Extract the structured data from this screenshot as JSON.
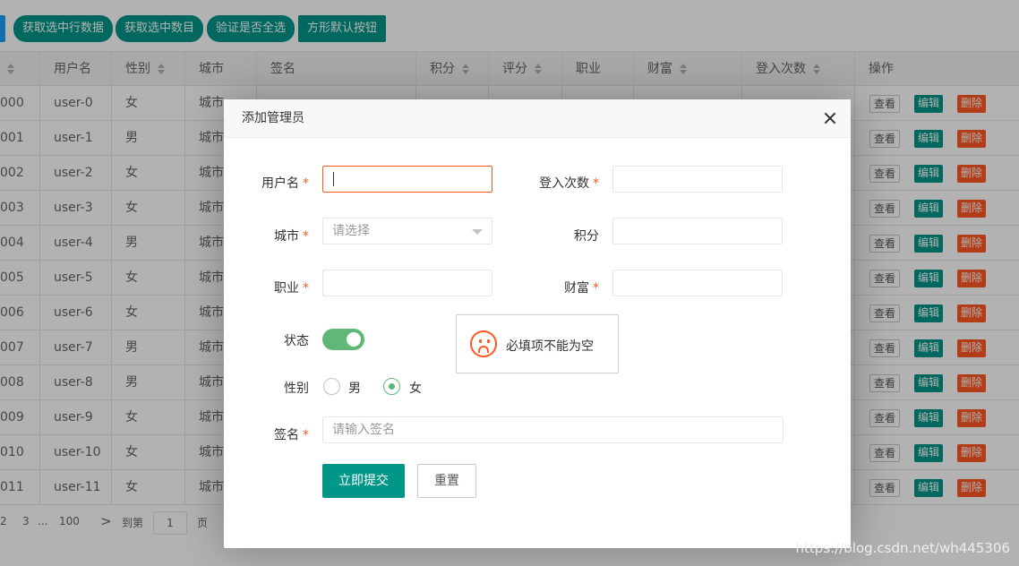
{
  "toolbar": {
    "buttons": [
      "获取选中行数据",
      "获取选中数目",
      "验证是否全选",
      "方形默认按钮"
    ]
  },
  "table": {
    "headers": [
      "用户名",
      "性别",
      "城市",
      "签名",
      "积分",
      "评分",
      "职业",
      "财富",
      "登入次数",
      "操作"
    ],
    "rows": [
      {
        "id": "000",
        "user": "user-0",
        "sex": "女",
        "city": "城市"
      },
      {
        "id": "001",
        "user": "user-1",
        "sex": "男",
        "city": "城市"
      },
      {
        "id": "002",
        "user": "user-2",
        "sex": "女",
        "city": "城市"
      },
      {
        "id": "003",
        "user": "user-3",
        "sex": "女",
        "city": "城市"
      },
      {
        "id": "004",
        "user": "user-4",
        "sex": "男",
        "city": "城市"
      },
      {
        "id": "005",
        "user": "user-5",
        "sex": "女",
        "city": "城市"
      },
      {
        "id": "006",
        "user": "user-6",
        "sex": "女",
        "city": "城市"
      },
      {
        "id": "007",
        "user": "user-7",
        "sex": "男",
        "city": "城市"
      },
      {
        "id": "008",
        "user": "user-8",
        "sex": "男",
        "city": "城市"
      },
      {
        "id": "009",
        "user": "user-9",
        "sex": "女",
        "city": "城市"
      },
      {
        "id": "010",
        "user": "user-10",
        "sex": "女",
        "city": "城市"
      },
      {
        "id": "011",
        "user": "user-11",
        "sex": "女",
        "city": "城市"
      }
    ],
    "ops": {
      "view": "查看",
      "edit": "编辑",
      "delete": "删除"
    }
  },
  "pager": {
    "p2": "2",
    "p3": "3",
    "ellipsis": "...",
    "last": "100",
    "next": ">",
    "goto": "到第",
    "page_value": "1",
    "page_unit": "页"
  },
  "dialog": {
    "title": "添加管理员",
    "fields": {
      "username": "用户名",
      "login_count": "登入次数",
      "city": "城市",
      "city_placeholder": "请选择",
      "points": "积分",
      "job": "职业",
      "wealth": "财富",
      "status": "状态",
      "sex": "性别",
      "sex_male": "男",
      "sex_female": "女",
      "sign": "签名",
      "sign_placeholder": "请输入签名",
      "required_mark": "*"
    },
    "tip": "必填项不能为空",
    "submit": "立即提交",
    "reset": "重置"
  },
  "watermark": "https://blog.csdn.net/wh445306",
  "colors": {
    "primary": "#009688",
    "danger": "#ff5722",
    "success": "#5fb878"
  }
}
